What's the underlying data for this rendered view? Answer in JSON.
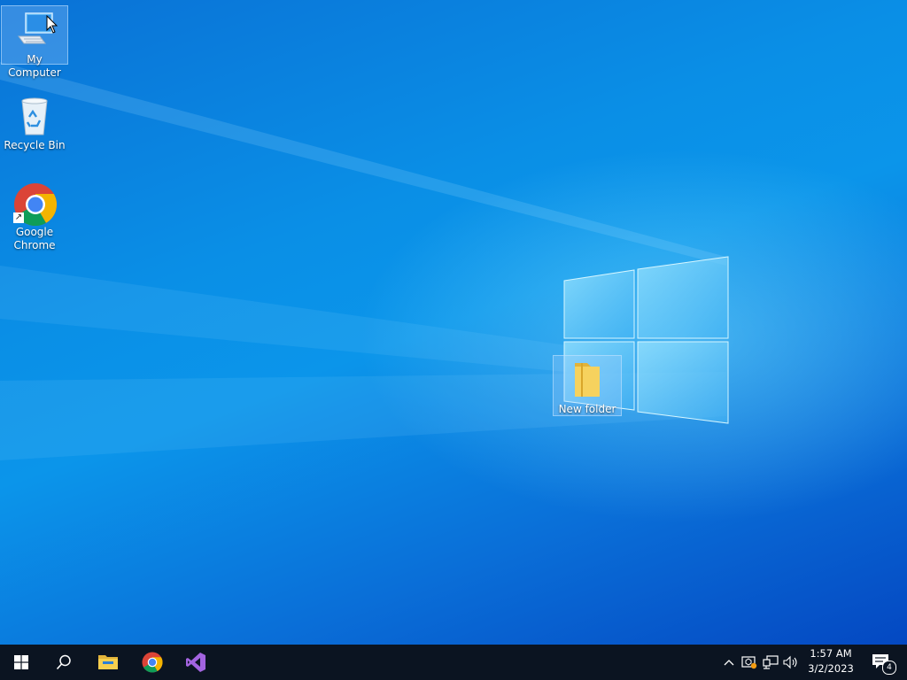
{
  "desktop": {
    "icons": [
      {
        "label": "My Computer",
        "icon": "computer-icon",
        "selected": true
      },
      {
        "label": "Recycle Bin",
        "icon": "recycle-bin-icon",
        "selected": false
      },
      {
        "label": "Google Chrome",
        "icon": "chrome-icon",
        "selected": false
      },
      {
        "label": "New folder",
        "icon": "folder-icon",
        "selected": true
      }
    ]
  },
  "taskbar": {
    "pinned": [
      {
        "name": "start",
        "icon": "windows-start-icon"
      },
      {
        "name": "search",
        "icon": "search-icon"
      },
      {
        "name": "file-explorer",
        "icon": "folder-icon"
      },
      {
        "name": "chrome",
        "icon": "chrome-icon"
      },
      {
        "name": "visual-studio",
        "icon": "visual-studio-icon"
      }
    ],
    "tray": {
      "icons": [
        "chevron-up-icon",
        "security-icon",
        "network-icon",
        "volume-icon"
      ],
      "time": "1:57 AM",
      "date": "3/2/2023",
      "notifications": "4"
    }
  },
  "colors": {
    "taskbar": "#0b1421",
    "desktop_accent": "#0a8fe6",
    "visual_studio": "#a364e0"
  }
}
